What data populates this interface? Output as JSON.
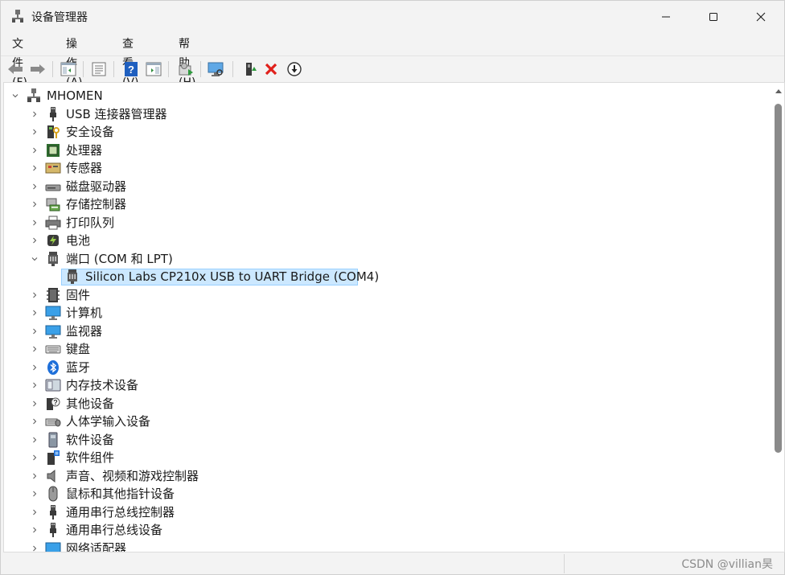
{
  "window": {
    "title": "设备管理器"
  },
  "menu": [
    "文件(F)",
    "操作(A)",
    "查看(V)",
    "帮助(H)"
  ],
  "toolbar": [
    "back-arrow-icon",
    "forward-arrow-icon",
    "show-hide-tree-icon",
    "properties-icon",
    "help-icon",
    "action-pane-icon",
    "update-driver-icon",
    "scan-hardware-icon",
    "add-legacy-hardware-icon",
    "uninstall-device-icon",
    "disable-device-icon"
  ],
  "tree": {
    "root": "MHOMEN",
    "items": [
      {
        "label": "USB 连接器管理器",
        "icon": "usb-connector-icon"
      },
      {
        "label": "安全设备",
        "icon": "security-device-icon"
      },
      {
        "label": "处理器",
        "icon": "processor-icon"
      },
      {
        "label": "传感器",
        "icon": "sensor-icon"
      },
      {
        "label": "磁盘驱动器",
        "icon": "disk-drive-icon"
      },
      {
        "label": "存储控制器",
        "icon": "storage-controller-icon"
      },
      {
        "label": "打印队列",
        "icon": "printer-icon"
      },
      {
        "label": "电池",
        "icon": "battery-icon"
      },
      {
        "label": "端口 (COM 和 LPT)",
        "icon": "port-icon",
        "expanded": true,
        "children": [
          {
            "label": "Silicon Labs CP210x USB to UART Bridge (COM4)",
            "icon": "port-icon",
            "selected": true
          }
        ]
      },
      {
        "label": "固件",
        "icon": "firmware-icon"
      },
      {
        "label": "计算机",
        "icon": "computer-icon"
      },
      {
        "label": "监视器",
        "icon": "monitor-icon"
      },
      {
        "label": "键盘",
        "icon": "keyboard-icon"
      },
      {
        "label": "蓝牙",
        "icon": "bluetooth-icon"
      },
      {
        "label": "内存技术设备",
        "icon": "memory-tech-icon"
      },
      {
        "label": "其他设备",
        "icon": "other-device-icon"
      },
      {
        "label": "人体学输入设备",
        "icon": "hid-icon"
      },
      {
        "label": "软件设备",
        "icon": "software-device-icon"
      },
      {
        "label": "软件组件",
        "icon": "software-component-icon"
      },
      {
        "label": "声音、视频和游戏控制器",
        "icon": "audio-icon"
      },
      {
        "label": "鼠标和其他指针设备",
        "icon": "mouse-icon"
      },
      {
        "label": "通用串行总线控制器",
        "icon": "usb-controller-icon"
      },
      {
        "label": "通用串行总线设备",
        "icon": "usb-device-icon"
      },
      {
        "label": "网络适配器",
        "icon": "network-adapter-icon"
      }
    ]
  },
  "status": {
    "watermark": "CSDN @villian昊"
  },
  "colors": {
    "selection": "#cce8ff",
    "selection_border": "#99d1ff",
    "close_red": "#e0201b",
    "help_blue": "#1f5fbf"
  }
}
